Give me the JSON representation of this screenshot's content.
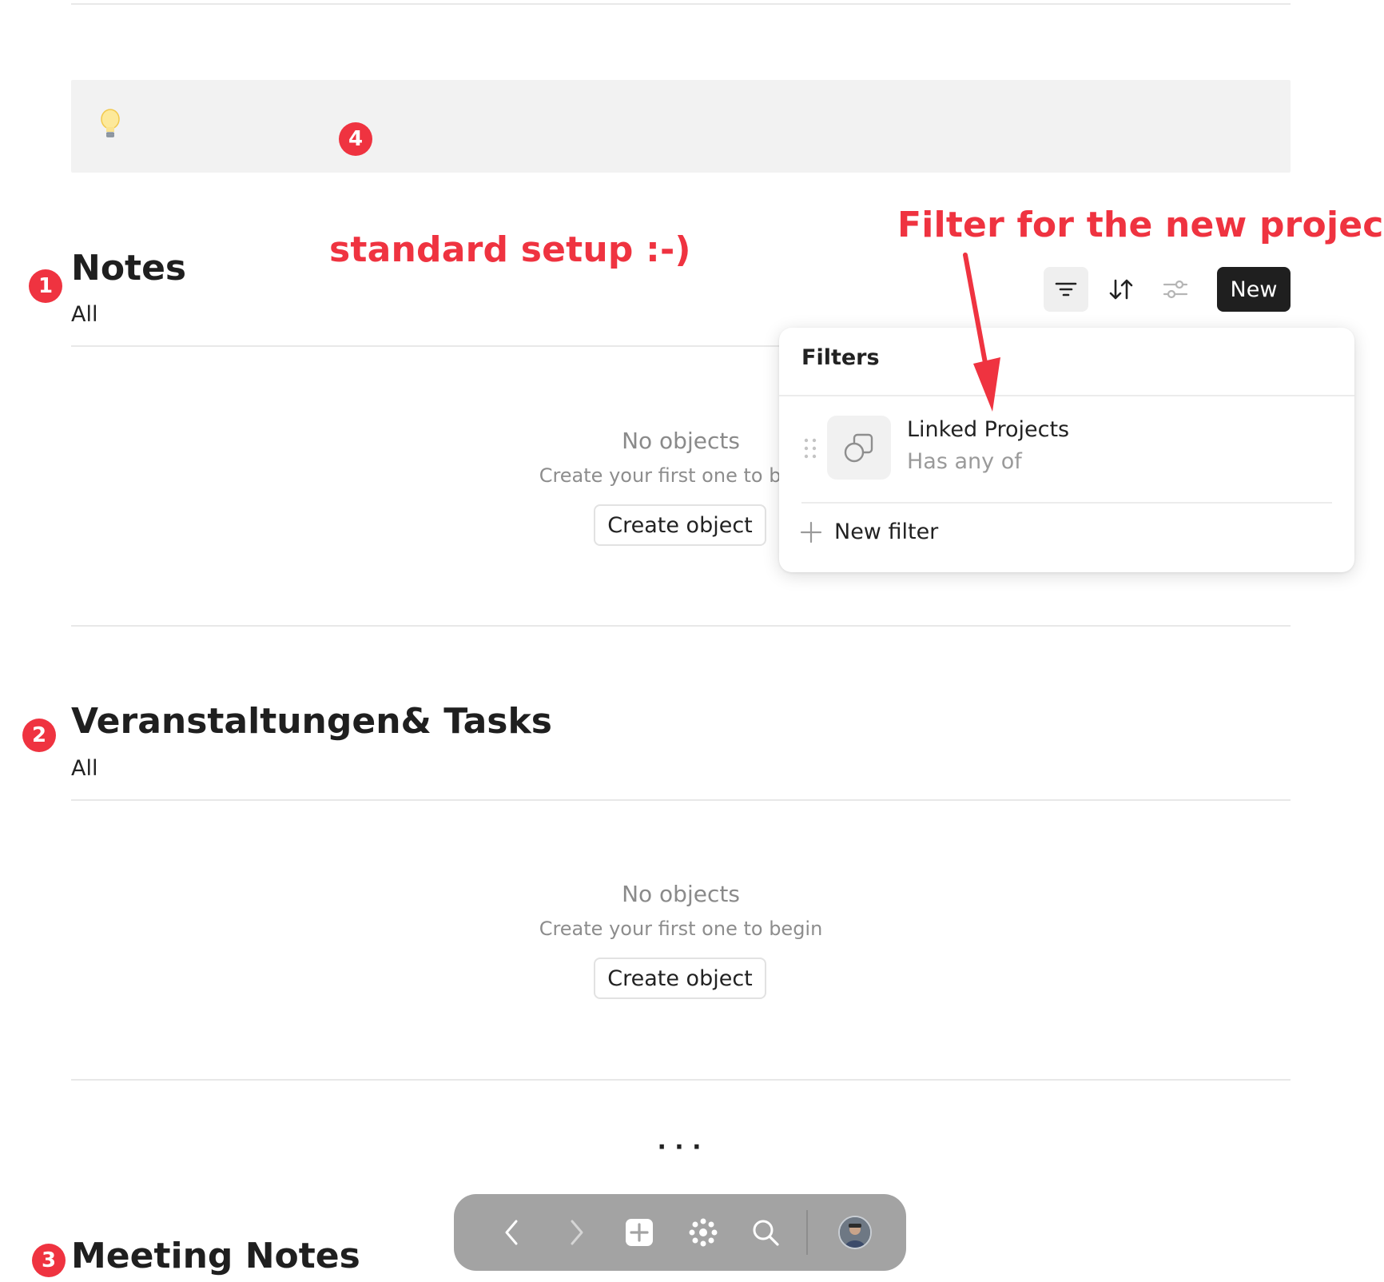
{
  "callout": {
    "icon": "lightbulb-icon"
  },
  "markers": {
    "m1": "1",
    "m2": "2",
    "m3": "3",
    "m4": "4"
  },
  "annotations": {
    "setup": "standard setup :-)",
    "filter_note": "Filter for the new project",
    "color": "#ef3340"
  },
  "notes": {
    "title": "Notes",
    "view": "All",
    "empty_title": "No objects",
    "empty_sub": "Create your first one to begin",
    "create_label": "Create object"
  },
  "toolbar": {
    "filter_icon": "filter-icon",
    "sort_icon": "sort-icon",
    "settings_icon": "sliders-icon",
    "new_label": "New"
  },
  "filters_popup": {
    "title": "Filters",
    "items": [
      {
        "name": "Linked Projects",
        "condition": "Has any of",
        "icon": "linked-objects-icon"
      }
    ],
    "new_filter_label": "New filter"
  },
  "events": {
    "title": "Veranstaltungen& Tasks",
    "view": "All",
    "empty_title": "No objects",
    "empty_sub": "Create your first one to begin",
    "create_label": "Create object"
  },
  "more_indicator": "· · ·",
  "meeting": {
    "title": "Meeting Notes"
  },
  "dock": {
    "items": [
      "back-icon",
      "forward-icon",
      "add-icon",
      "graph-icon",
      "search-icon",
      "avatar"
    ]
  }
}
